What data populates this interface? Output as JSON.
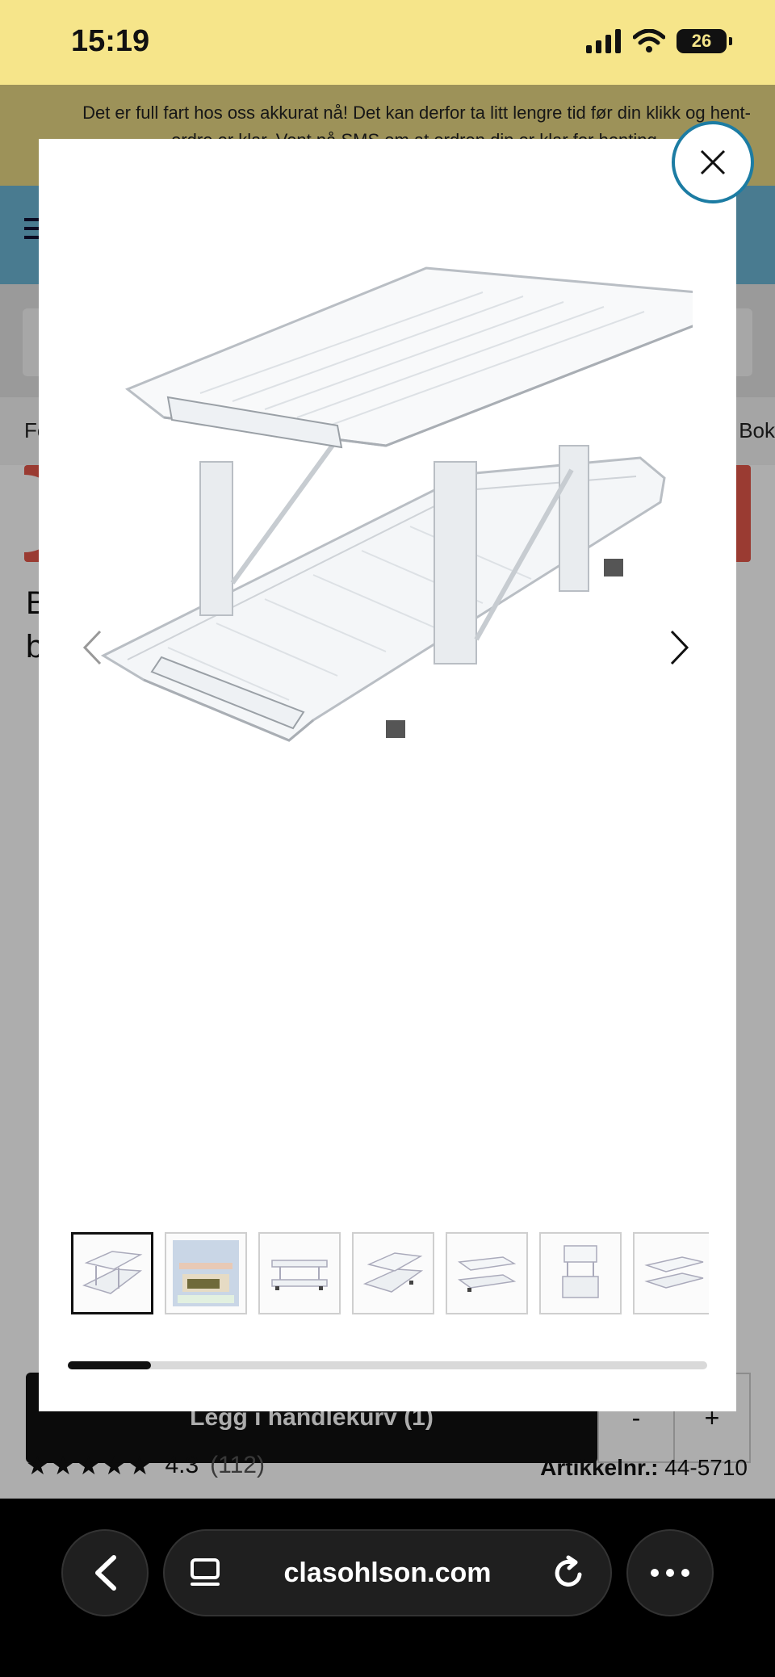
{
  "status_bar": {
    "time": "15:19",
    "battery": "26"
  },
  "notice": {
    "text": "Det er full fart hos oss akkurat nå! Det kan derfor ta litt lengre tid før din klikk og hent-ordre er klar. Vent på SMS om at ordren din er klar for henting."
  },
  "categories": {
    "left": "Fo",
    "right": "Bok"
  },
  "product": {
    "title_fragment": "B b"
  },
  "purchase": {
    "add_to_cart_label": "Legg i handlekurv (1)",
    "qty_minus": "-",
    "qty_plus": "+"
  },
  "rating": {
    "stars": "★★★★★",
    "value": "4.3",
    "count": "(112)"
  },
  "article": {
    "label": "Artikkelnr.:",
    "number": "44-5710"
  },
  "gallery": {
    "thumbnails": [
      "organizer-front",
      "organizer-in-fridge",
      "organizer-side",
      "organizer-angle",
      "organizer-low",
      "organizer-end",
      "organizer-top"
    ],
    "active_index": 0,
    "scroll_fraction": 0.13
  },
  "browser": {
    "url": "clasohlson.com"
  },
  "colors": {
    "close_ring": "#1c7ca3",
    "header": "#6cb6d4",
    "notice": "#e7d884",
    "status": "#f6e58a",
    "promo": "#e4584a"
  }
}
